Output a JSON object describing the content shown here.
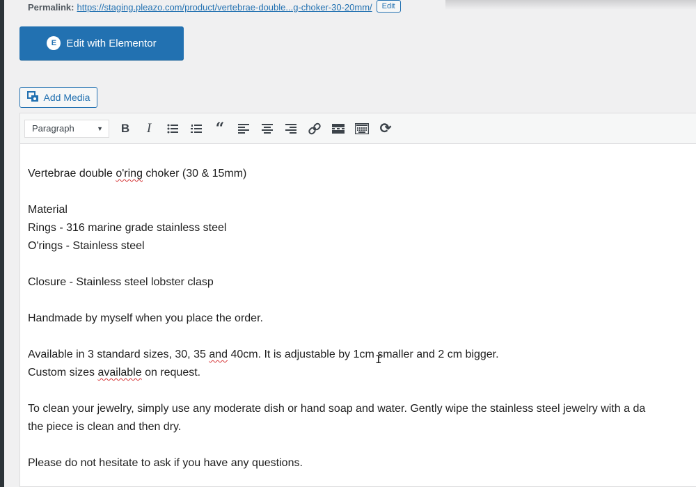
{
  "permalink": {
    "label": "Permalink:",
    "url_text": "https://staging.pleazo.com/product/vertebrae-double...g-choker-30-20mm/",
    "edit_label": "Edit"
  },
  "elementor": {
    "button_label": "Edit with Elementor",
    "icon_text": "E"
  },
  "media": {
    "add_media_label": "Add Media"
  },
  "toolbar": {
    "format_value": "Paragraph",
    "buttons": [
      {
        "name": "bold",
        "glyph": "B"
      },
      {
        "name": "italic",
        "glyph": "I"
      },
      {
        "name": "bullet-list",
        "glyph": ""
      },
      {
        "name": "numbered-list",
        "glyph": ""
      },
      {
        "name": "blockquote",
        "glyph": "“"
      },
      {
        "name": "align-left",
        "glyph": ""
      },
      {
        "name": "align-center",
        "glyph": ""
      },
      {
        "name": "align-right",
        "glyph": ""
      },
      {
        "name": "link",
        "glyph": ""
      },
      {
        "name": "read-more",
        "glyph": ""
      },
      {
        "name": "toolbar-toggle",
        "glyph": ""
      },
      {
        "name": "refresh",
        "glyph": "⟳"
      }
    ]
  },
  "content": {
    "line1_a": "Vertebrae double ",
    "line1_b": "o'ring",
    "line1_c": " choker (30 & 15mm)",
    "material": "Material",
    "rings": "Rings - 316 marine grade stainless steel",
    "orings": "O'rings - Stainless steel",
    "closure": "Closure - Stainless steel lobster clasp",
    "handmade": "Handmade by myself when you place the order.",
    "sizes_a": "Available in 3 standard sizes, 30, 35 ",
    "sizes_b": "and",
    "sizes_c": " 40cm. It is adjustable by 1cm smaller and 2 cm bigger.",
    "custom_a": "Custom sizes ",
    "custom_b": "available",
    "custom_c": " on request.",
    "clean1": "To clean your jewelry, simply use any moderate dish or hand soap and water. Gently wipe the stainless steel jewelry with a da",
    "clean2": "the piece is clean and then dry.",
    "ask": "Please do not hesitate to ask if you have any questions."
  }
}
